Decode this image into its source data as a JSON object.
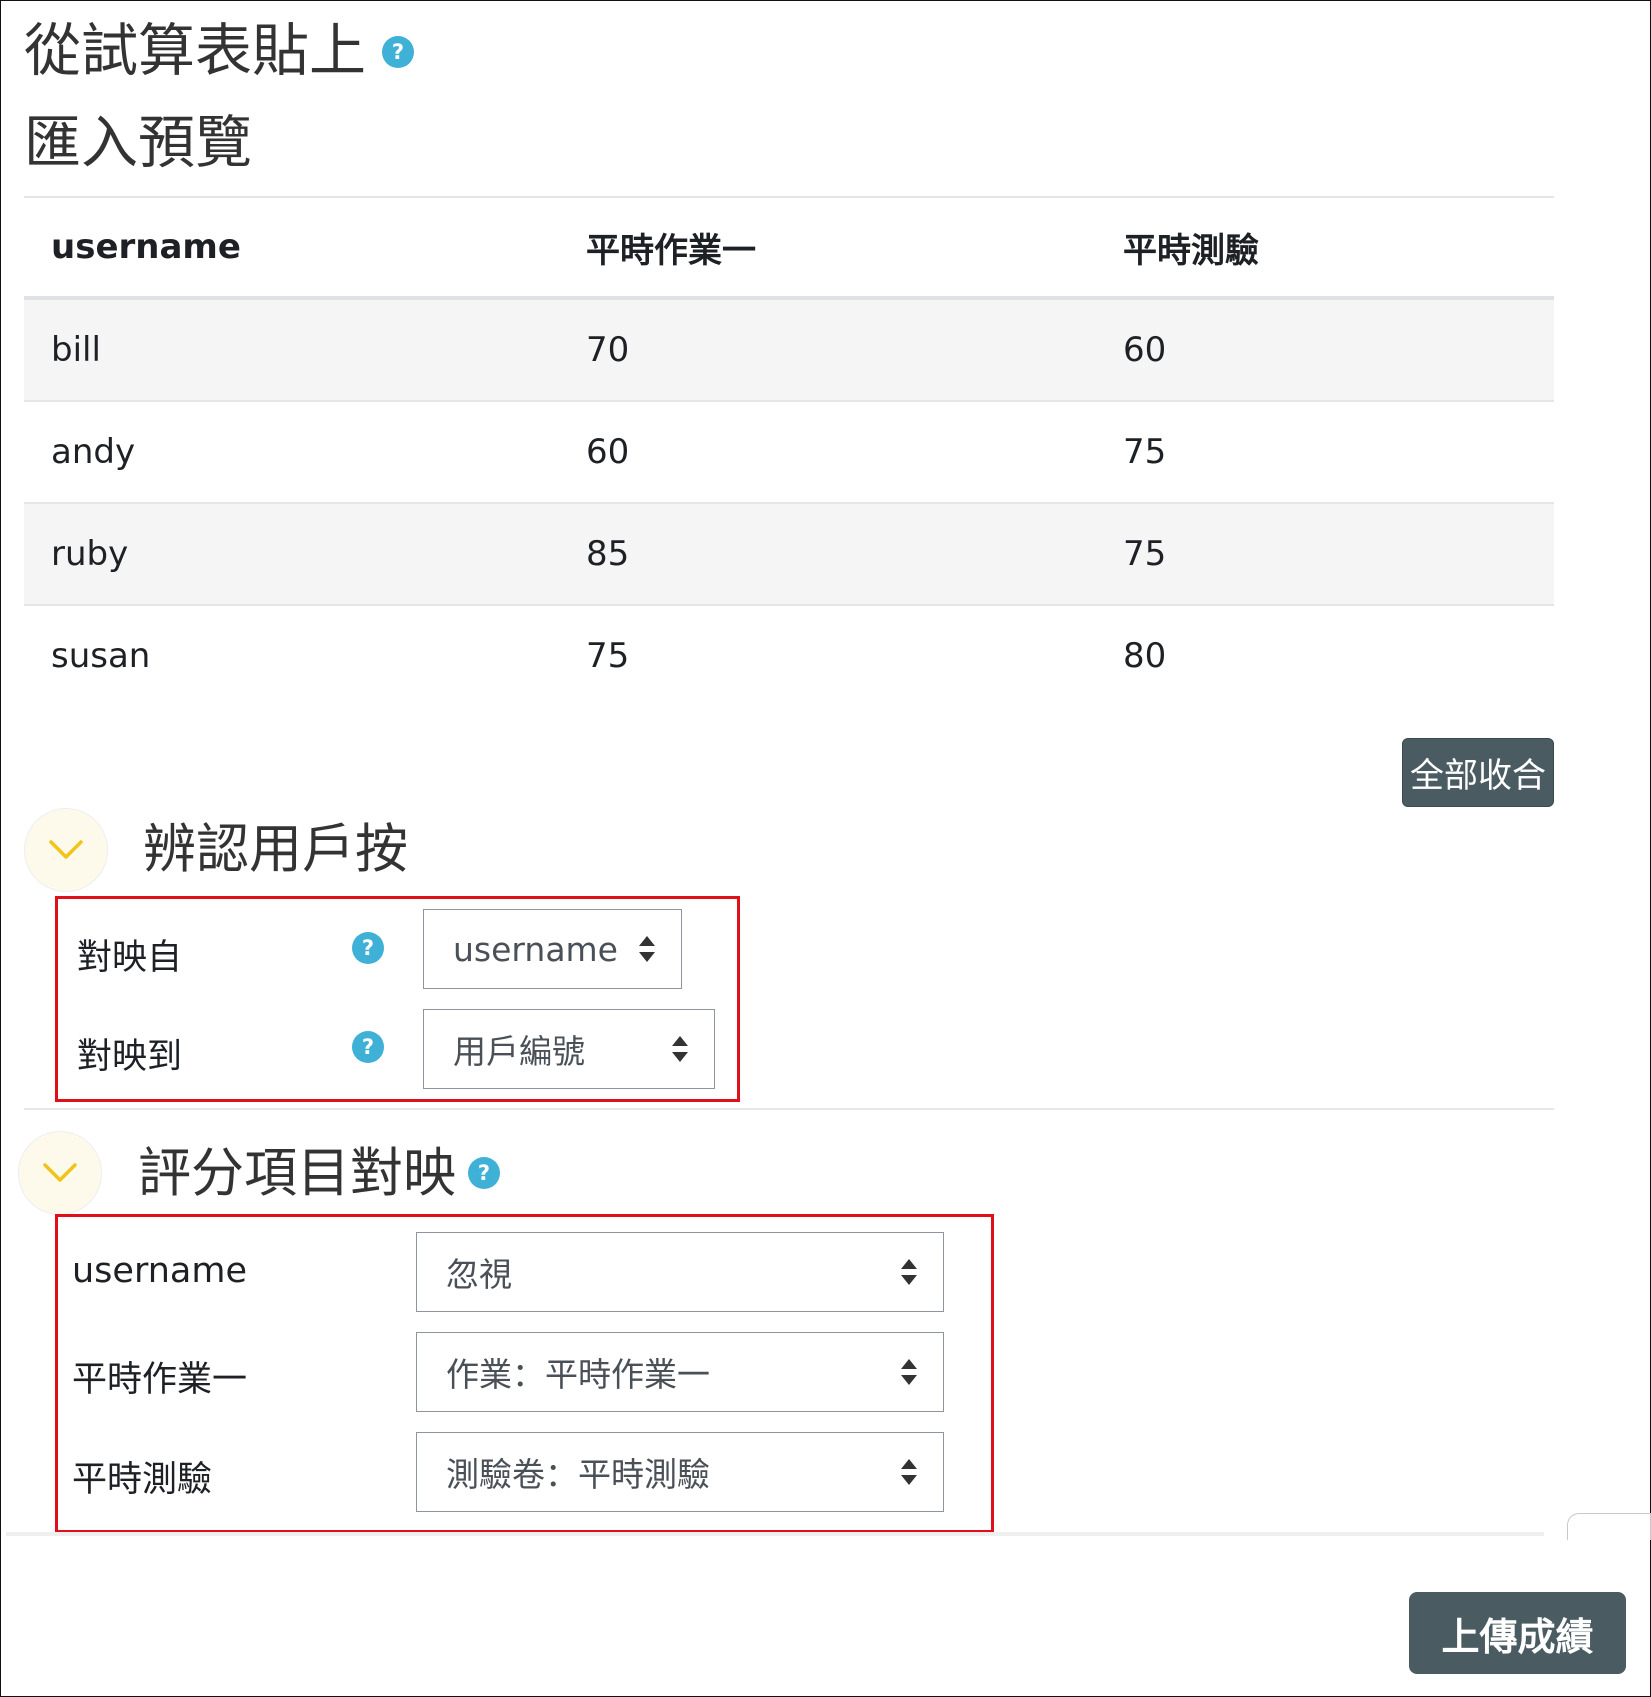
{
  "header": {
    "title": "從試算表貼上",
    "preview_title": "匯入預覽"
  },
  "preview_table": {
    "columns": [
      "username",
      "平時作業一",
      "平時測驗"
    ],
    "rows": [
      [
        "bill",
        "70",
        "60"
      ],
      [
        "andy",
        "60",
        "75"
      ],
      [
        "ruby",
        "85",
        "75"
      ],
      [
        "susan",
        "75",
        "80"
      ]
    ]
  },
  "collapse_all_label": "全部收合",
  "identify_section": {
    "title": "辨認用戶按",
    "map_from_label": "對映自",
    "map_from_value": "username",
    "map_to_label": "對映到",
    "map_to_value": "用戶編號"
  },
  "grade_mapping_section": {
    "title": "評分項目對映",
    "items": [
      {
        "label": "username",
        "value": "忽視"
      },
      {
        "label": "平時作業一",
        "value": "作業：平時作業一"
      },
      {
        "label": "平時測驗",
        "value": "測驗卷：平時測驗"
      }
    ]
  },
  "upload_button_label": "上傳成績",
  "help_icon_glyph": "?",
  "colors": {
    "button_bg": "#4a5c62",
    "help_icon": "#3fb0d6",
    "highlight_box": "#e0101a",
    "chevron": "#f0c419"
  }
}
